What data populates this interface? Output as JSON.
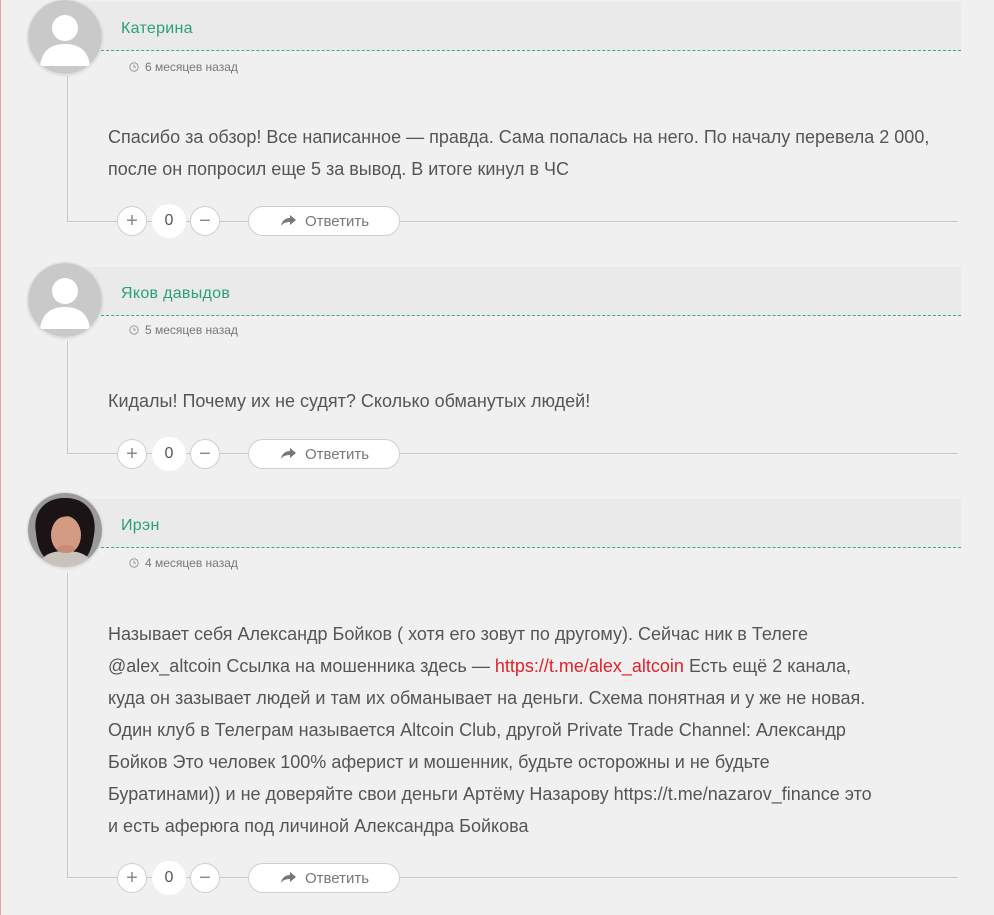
{
  "comments": [
    {
      "author": "Катерина",
      "date": "6 месяцев назад",
      "text": "Спасибо за обзор! Все написанное — правда. Сама попалась на него. По началу перевела 2 000, после он попросил еще 5 за вывод. В итоге кинул в ЧС",
      "votes": "0",
      "reply_label": "Ответить",
      "avatar": "default-user-avatar"
    },
    {
      "author": "Яков давыдов",
      "date": "5 месяцев назад",
      "text": "Кидалы! Почему их не судят? Сколько обманутых людей!",
      "votes": "0",
      "reply_label": "Ответить",
      "avatar": "default-user-avatar"
    },
    {
      "author": "Ирэн",
      "date": "4 месяцев назад",
      "text_part1": "Называет себя Александр Бойков ( хотя его зовут по другому). Сейчас ник в Телеге\n@alex_altcoin Ссылка на мошенника здесь — ",
      "link": "https://t.me/alex_altcoin",
      "text_part2": " Есть ещё 2 канала,\nкуда он зазывает людей и там их обманывает на деньги. Схема понятная и у же не новая.\nОдин клуб в Телеграм называется Altcoin Club, другой Private Trade Channel: Александр\nБойков Это человек 100% аферист и мошенник, будьте осторожны и не будьте\nБуратинами)) и не доверяйте свои деньги Артёму Назарову https://t.me/nazarov_finance это\nи есть аферюга под личиной Александра Бойкова",
      "votes": "0",
      "reply_label": "Ответить",
      "avatar": "user-photo-avatar"
    }
  ],
  "vote_plus": "+",
  "vote_minus": "−",
  "colors": {
    "author": "#2aa174",
    "link": "#e0202a",
    "header_band": "#eaeaea"
  }
}
